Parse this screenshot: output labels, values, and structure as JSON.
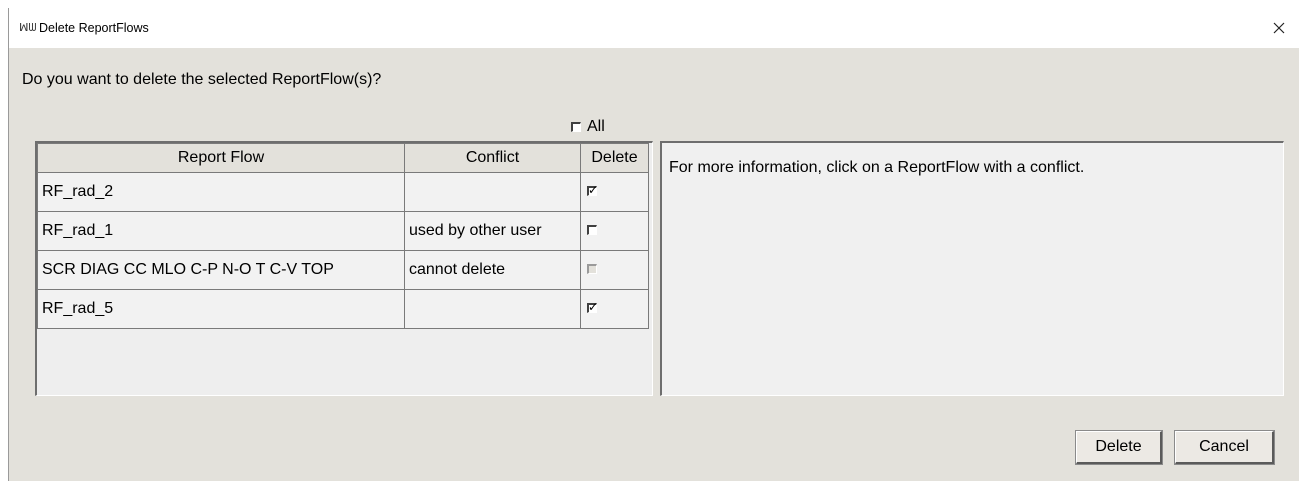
{
  "window": {
    "title": "Delete ReportFlows",
    "icon": "app-logo-icon",
    "close_icon": "close-icon"
  },
  "question": "Do you want to delete the selected ReportFlow(s)?",
  "select_all": {
    "label": "All",
    "checked": false
  },
  "table": {
    "columns": [
      "Report Flow",
      "Conflict",
      "Delete"
    ],
    "rows": [
      {
        "report_flow": "RF_rad_2",
        "conflict": "",
        "delete": "checked"
      },
      {
        "report_flow": "RF_rad_1",
        "conflict": "used by other user",
        "delete": "unchecked"
      },
      {
        "report_flow": "SCR DIAG CC MLO C-P N-O T C-V TOP",
        "conflict": "cannot delete",
        "delete": "disabled"
      },
      {
        "report_flow": "RF_rad_5",
        "conflict": "",
        "delete": "checked"
      }
    ]
  },
  "info_text": "For more information, click on a ReportFlow with a conflict.",
  "buttons": {
    "delete": "Delete",
    "cancel": "Cancel"
  }
}
